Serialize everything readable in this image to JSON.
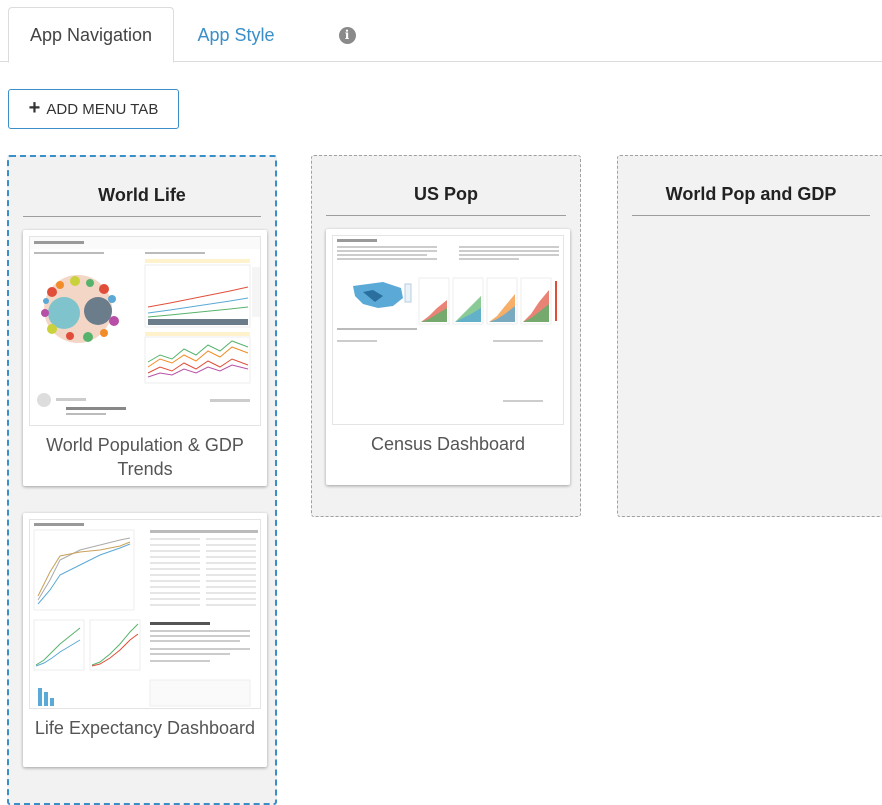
{
  "tabs": [
    {
      "label": "App Navigation",
      "active": true
    },
    {
      "label": "App Style",
      "active": false
    },
    {
      "label": "i",
      "icon": "info-icon"
    }
  ],
  "toolbar": {
    "add_menu_tab_label": "ADD MENU TAB",
    "add_icon": "plus-icon"
  },
  "columns": [
    {
      "title": "World Life",
      "cards": [
        {
          "title": "World Population & GDP Trends"
        },
        {
          "title": "Life Expectancy Dashboard"
        }
      ]
    },
    {
      "title": "US Pop",
      "cards": [
        {
          "title": "Census Dashboard"
        }
      ]
    },
    {
      "title": "World Pop and GDP",
      "cards": []
    }
  ],
  "colors": {
    "accent": "#3a8fc9",
    "panel": "#f2f2f2",
    "border": "#dcdcdc"
  }
}
